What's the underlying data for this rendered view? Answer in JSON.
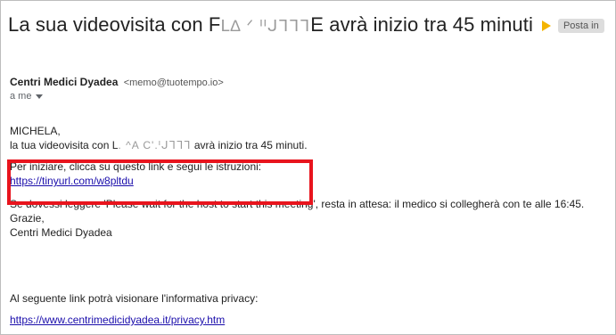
{
  "email": {
    "subject_prefix": "La sua videovisita con F",
    "subject_redacted": "ᒪ∆ ᐟ ᑊᑊᒍᒣᒣᒣ",
    "subject_suffix": "E avrà inizio tra 45 minuti",
    "label": "Posta in",
    "sender_name": "Centri Medici Dyadea",
    "sender_email": "<memo@tuotempo.io>",
    "recipient": "a me",
    "greeting": "MICHELA,",
    "line1_prefix": "la tua videovisita con L",
    "line1_redacted": ". ^A C'.ᑊᒍᒣᒣᒣ",
    "line1_suffix": " avrà inizio tra 45 minuti.",
    "instructions": "Per iniziare, clicca su questo link e segui le istruzioni:",
    "meeting_link": "https://tinyurl.com/w8pltdu",
    "wait_notice": "Se dovessi leggere 'Please wait for the host to start this meeting', resta in attesa: il medico si collegherà con te alle 16:45.",
    "thanks": "Grazie,",
    "signature": "Centri Medici Dyadea",
    "privacy_text": "Al seguente link potrà visionare l'informativa privacy:",
    "privacy_link": "https://www.centrimedicidyadea.it/privacy.htm"
  },
  "colors": {
    "highlight": "#e8141d",
    "link": "#1a0dab",
    "important": "#f4b400"
  },
  "icons": {
    "important": "important-marker-icon",
    "expand": "chevron-down-icon"
  }
}
